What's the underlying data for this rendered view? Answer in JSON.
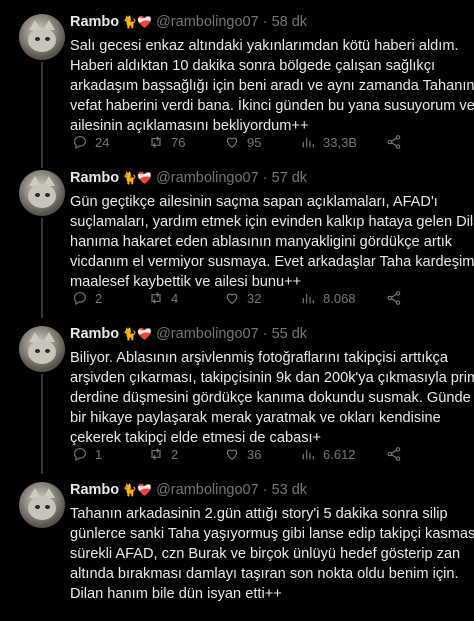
{
  "tweets": [
    {
      "name": "Rambo",
      "badges": "🐈❤️‍🩹",
      "handle": "@rambolingo07",
      "dot": "·",
      "time": "58 dk",
      "lines": [
        "Salı gecesi enkaz altındaki yakınlarımdan kötü haberi aldım.",
        "Haberi aldıktan 10 dakika sonra bölgede çalışan sağlıkçı",
        "arkadaşım başsağlığı için beni aradı ve aynı zamanda Tahanın da",
        "vefat haberini verdi bana. İkinci günden bu yana susuyorum ve",
        "ailesinin açıklamasını bekliyordum++"
      ],
      "replies": "24",
      "retweets": "76",
      "likes": "95",
      "views": "33,3B"
    },
    {
      "name": "Rambo",
      "badges": "🐈❤️‍🩹",
      "handle": "@rambolingo07",
      "dot": "·",
      "time": "57 dk",
      "lines": [
        "Gün geçtikçe ailesinin saçma sapan açıklamaları, AFAD'ı",
        "suçlamaları, yardım etmek için evinden kalkıp hataya gelen Dilan",
        "hanıma hakaret eden ablasının manyakligini gördükçe artık",
        "vicdanım el vermiyor susmaya. Evet arkadaşlar Taha kardeşimizi",
        "maalesef kaybettik ve ailesi bunu++"
      ],
      "replies": "2",
      "retweets": "4",
      "likes": "32",
      "views": "8.068"
    },
    {
      "name": "Rambo",
      "badges": "🐈❤️‍🩹",
      "handle": "@rambolingo07",
      "dot": "·",
      "time": "55 dk",
      "lines": [
        "Biliyor. Ablasının arşivlenmiş fotoğraflarını takipçisi arttıkça",
        "arşivden çıkarması, takipçisinin 9k dan 200k'ya çıkmasıyla prim",
        "derdine düşmesini gördükçe kanıma dokundu susmak. Günde",
        "bir hikaye paylaşarak merak yaratmak ve okları kendisine",
        "çekerek takipçi elde etmesi de cabası+"
      ],
      "replies": "1",
      "retweets": "2",
      "likes": "36",
      "views": "6.612"
    },
    {
      "name": "Rambo",
      "badges": "🐈❤️‍🩹",
      "handle": "@rambolingo07",
      "dot": "·",
      "time": "53 dk",
      "lines": [
        "Tahanın arkadasinin 2.gün attığı story'i 5 dakika sonra silip",
        "günlerce sanki Taha yaşıyormuş gibi lanse edip takipçi kasması,",
        "sürekli AFAD, czn Burak ve birçok ünlüyü hedef gösterip zan",
        "altında bırakması damlayı taşıran son nokta oldu benim için.",
        "Dilan hanım bile dün isyan etti++"
      ]
    }
  ]
}
